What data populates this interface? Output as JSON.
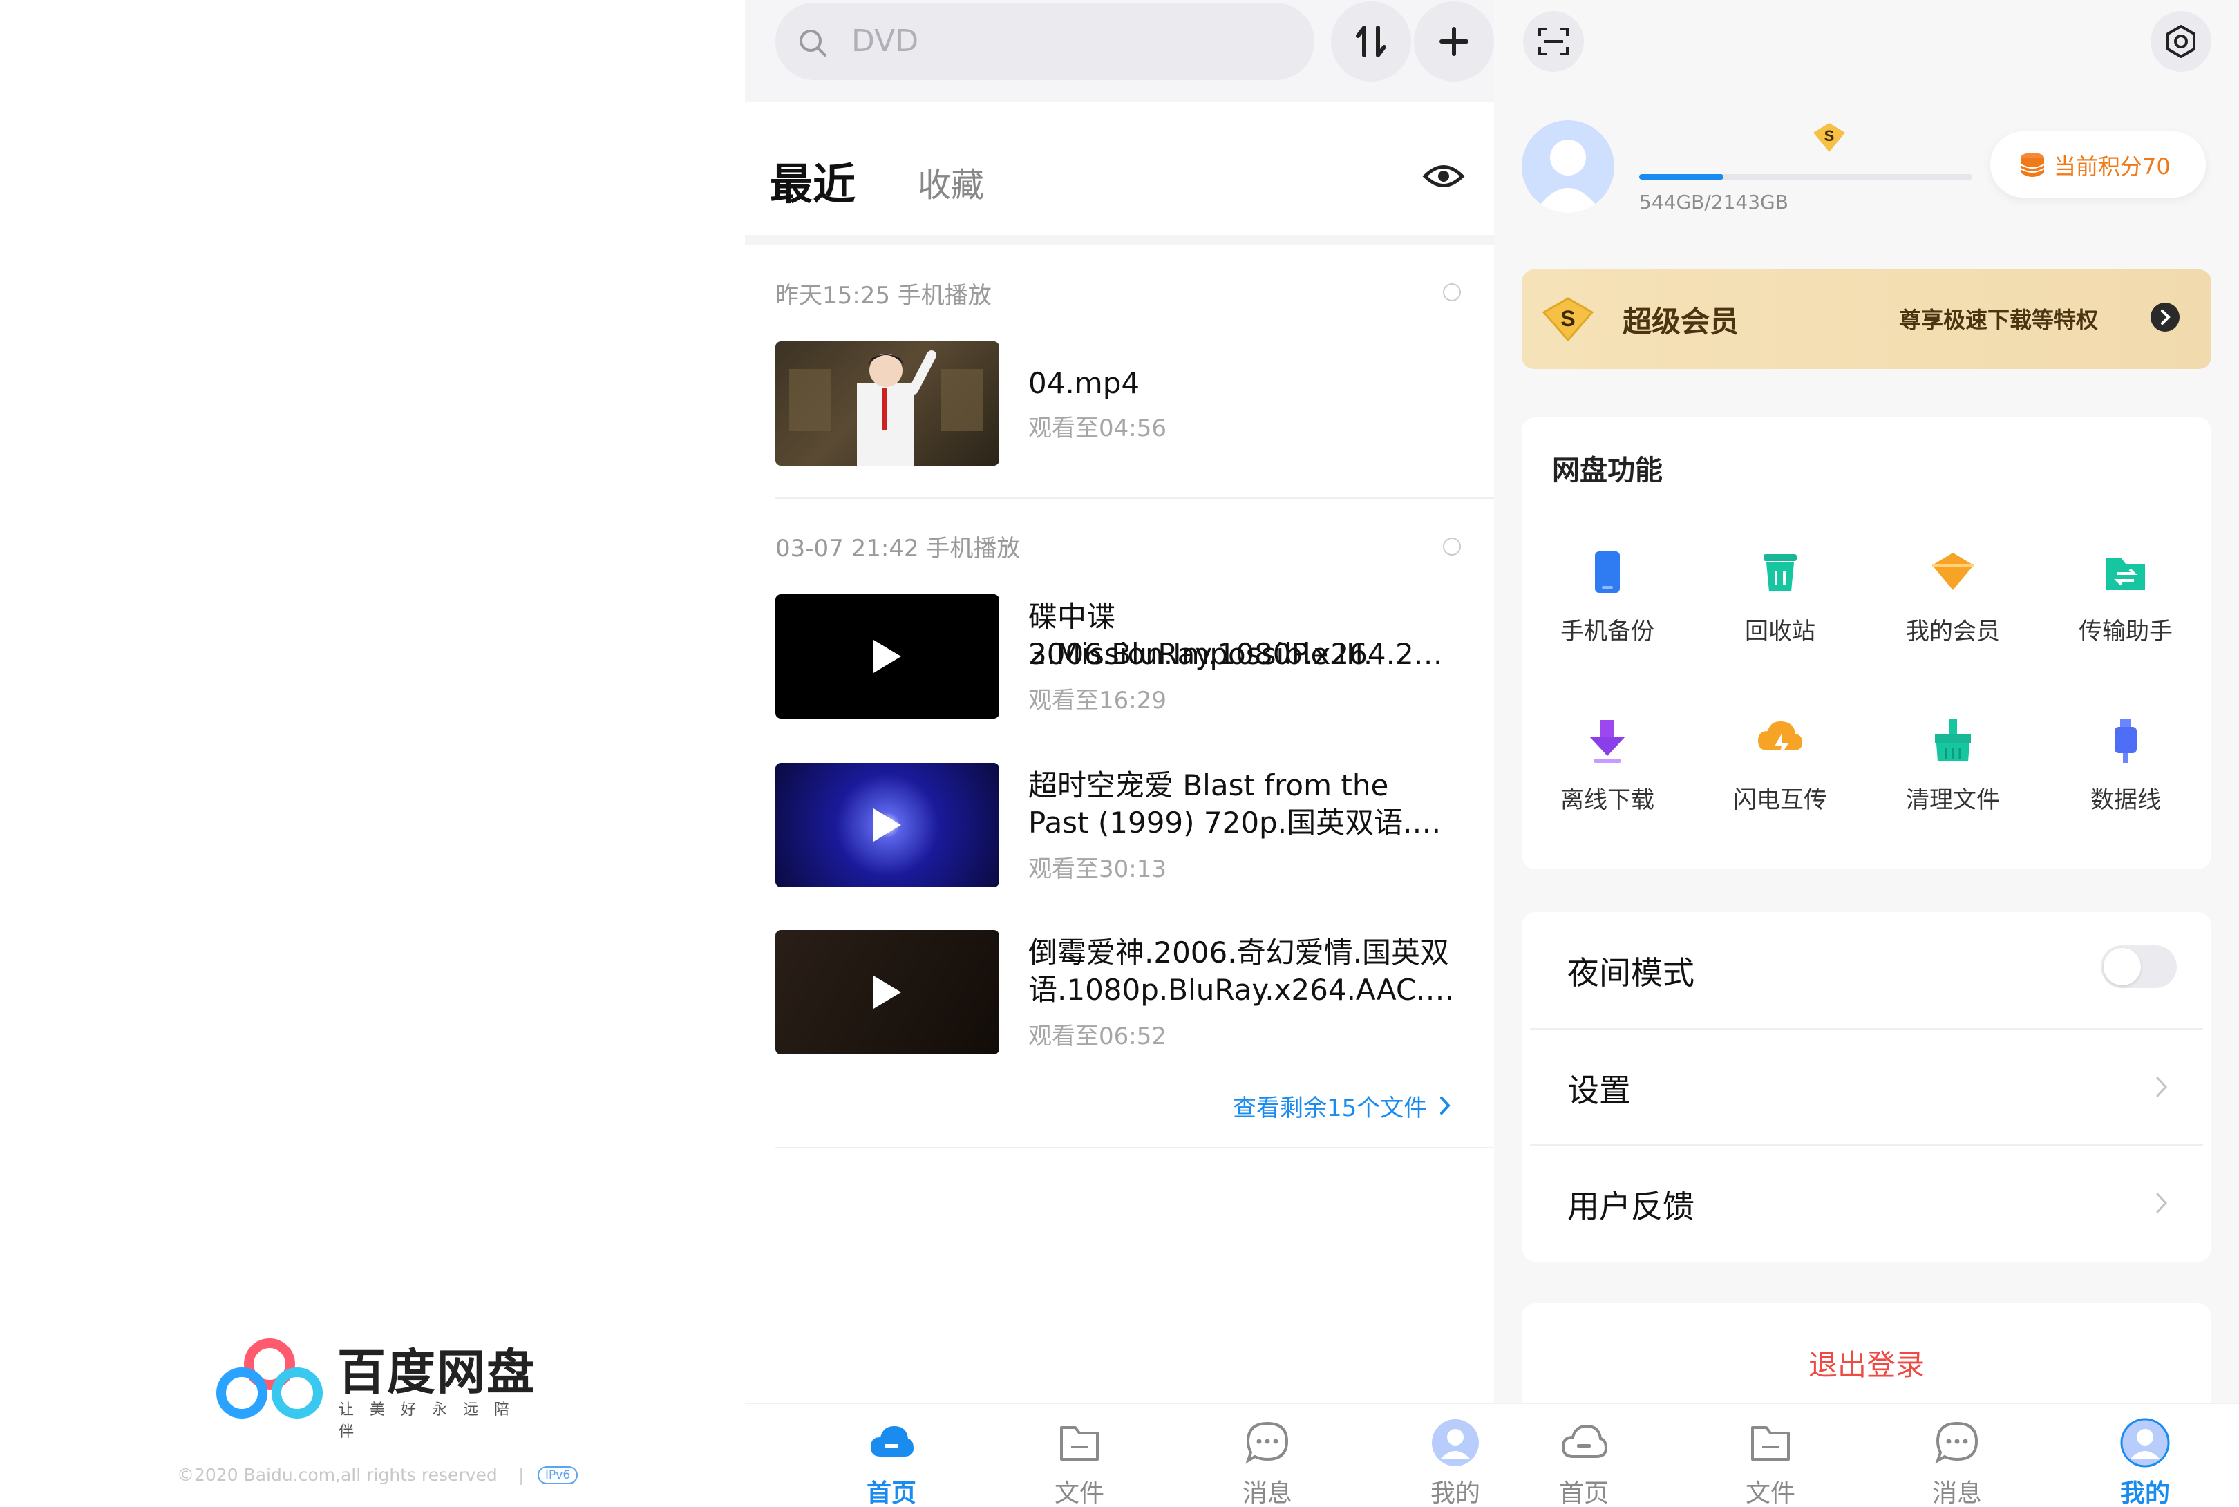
{
  "splash": {
    "brand_name": "百度网盘",
    "slogan": "让美好永远陪伴",
    "copyright": "©2020 Baidu.com,all rights reserved",
    "separator": "|",
    "ipv6_badge": "IPv6"
  },
  "home": {
    "search_placeholder": "DVD",
    "tabs": {
      "recent": "最近",
      "favorites": "收藏"
    },
    "groups": [
      {
        "header": "昨天15:25  手机播放",
        "items": [
          {
            "title": "04.mp4",
            "watched": "观看至04:56"
          }
        ]
      },
      {
        "header": "03-07 21:42  手机播放",
        "items": [
          {
            "title_line1": "碟中谍3.Mission.Impossible.III.",
            "title_line2": "2006.BluRay.1080P.x264.2…",
            "watched": "观看至16:29"
          },
          {
            "title_line1": "超时空宠爱 Blast from the",
            "title_line2": "Past (1999) 720p.国英双语.…",
            "watched": "观看至30:13"
          },
          {
            "title_line1": "倒霉爱神.2006.奇幻爱情.国英双",
            "title_line2": "语.1080p.BluRay.x264.AAC.…",
            "watched": "观看至06:52"
          }
        ]
      }
    ],
    "more_link": "查看剩余15个文件"
  },
  "mine": {
    "storage_text": "544GB/2143GB",
    "storage_used_fraction": 0.254,
    "points": "当前积分70",
    "vip_title": "超级会员",
    "vip_desc": "尊享极速下载等特权",
    "functions_title": "网盘功能",
    "functions": [
      {
        "label": "手机备份",
        "icon": "phone-backup-icon"
      },
      {
        "label": "回收站",
        "icon": "recycle-bin-icon"
      },
      {
        "label": "我的会员",
        "icon": "membership-icon"
      },
      {
        "label": "传输助手",
        "icon": "transfer-assistant-icon"
      },
      {
        "label": "离线下载",
        "icon": "offline-download-icon"
      },
      {
        "label": "闪电互传",
        "icon": "lightning-transfer-icon"
      },
      {
        "label": "清理文件",
        "icon": "cleanup-icon"
      },
      {
        "label": "数据线",
        "icon": "data-cable-icon"
      }
    ],
    "night_mode": "夜间模式",
    "settings": "设置",
    "feedback": "用户反馈",
    "logout": "退出登录"
  },
  "nav": {
    "home": "首页",
    "files": "文件",
    "messages": "消息",
    "me": "我的"
  },
  "colors": {
    "accent": "#1a8cf0",
    "danger": "#ef4a43",
    "vip_gold": "#f1dbae",
    "points_orange": "#f07a18"
  }
}
